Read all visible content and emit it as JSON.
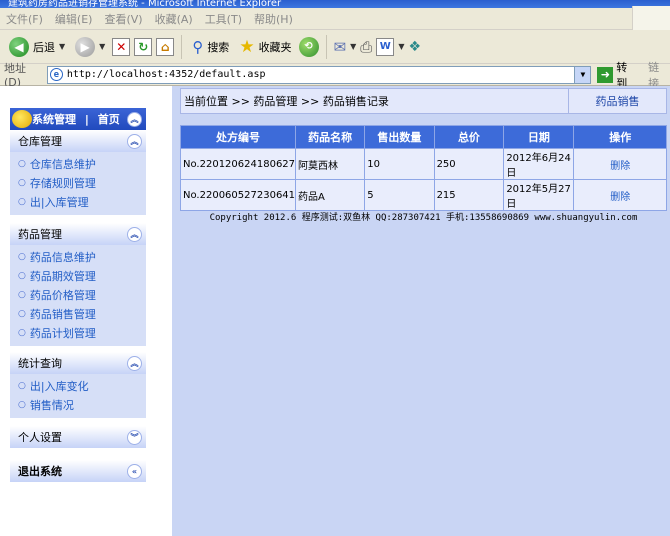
{
  "window": {
    "title": "建筑药房药品进销存管理系统 - Microsoft Internet Explorer"
  },
  "menu": [
    "文件(F)",
    "编辑(E)",
    "查看(V)",
    "收藏(A)",
    "工具(T)",
    "帮助(H)"
  ],
  "toolbar": {
    "back_label": "后退",
    "search_label": "搜索",
    "favorites_label": "收藏夹"
  },
  "address": {
    "label": "地址(D)",
    "url": "http://localhost:4352/default.asp",
    "go_label": "转到",
    "links_label": "链接"
  },
  "sidebar": {
    "header": {
      "title": "系统管理",
      "separator": "|",
      "home": "首页"
    },
    "groups": [
      {
        "title": "仓库管理",
        "items": [
          "仓库信息维护",
          "存储规则管理",
          "出|入库管理"
        ]
      },
      {
        "title": "药品管理",
        "items": [
          "药品信息维护",
          "药品期效管理",
          "药品价格管理",
          "药品销售管理",
          "药品计划管理"
        ]
      },
      {
        "title": "统计查询",
        "items": [
          "出|入库变化",
          "销售情况"
        ]
      },
      {
        "title": "个人设置",
        "items": []
      },
      {
        "title": "退出系统",
        "items": []
      }
    ]
  },
  "breadcrumb": {
    "text": "当前位置 >> 药品管理 >> 药品销售记录",
    "right": "药品销售"
  },
  "table": {
    "headers": [
      "处方编号",
      "药品名称",
      "售出数量",
      "总价",
      "日期",
      "操作"
    ],
    "rows": [
      [
        "No.220120624180627",
        "阿莫西林",
        "10",
        "250",
        "2012年6月24日",
        "删除"
      ],
      [
        "No.220060527230641",
        "药品A",
        "5",
        "215",
        "2012年5月27日",
        "删除"
      ]
    ]
  },
  "footer": "Copyright 2012.6 程序测试:双鱼林 QQ:287307421 手机:13558690869 www.shuangyulin.com"
}
